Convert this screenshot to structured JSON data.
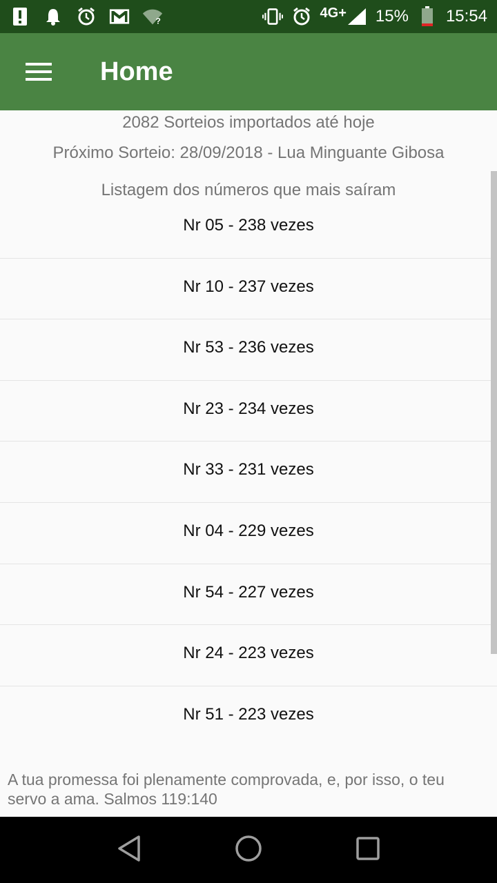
{
  "status_bar": {
    "network": "4G+",
    "battery_percent": "15%",
    "time": "15:54",
    "icons_left": [
      "alert-icon",
      "bell-icon",
      "alarm-icon",
      "gmail-icon",
      "wifi-question-icon"
    ],
    "icons_right": [
      "vibrate-icon",
      "alarm-icon",
      "signal-icon",
      "battery-icon"
    ]
  },
  "app_bar": {
    "title": "Home",
    "menu_icon": "hamburger-menu-icon"
  },
  "main": {
    "imported_count": "2082 Sorteios importados até hoje",
    "next_draw": "Próximo Sorteio: 28/09/2018 - Lua Minguante Gibosa",
    "list_heading": "Listagem dos números que mais saíram",
    "items": [
      "Nr 05 - 238 vezes",
      "Nr 10 - 237 vezes",
      "Nr 53 - 236 vezes",
      "Nr 23 - 234 vezes",
      "Nr 33 - 231 vezes",
      "Nr 04 - 229 vezes",
      "Nr 54 - 227 vezes",
      "Nr 24 - 223 vezes",
      "Nr 51 - 223 vezes"
    ],
    "footer_verse": "A tua promessa foi plenamente comprovada, e, por isso, o teu servo a ama. Salmos 119:140"
  },
  "nav_bar": {
    "buttons": [
      "back-icon",
      "home-icon",
      "recents-icon"
    ]
  },
  "colors": {
    "status_bar": "#1f4d1b",
    "app_bar": "#4a8443",
    "background": "#fafafa",
    "secondary_text": "#757575",
    "nav_bar": "#000000"
  }
}
